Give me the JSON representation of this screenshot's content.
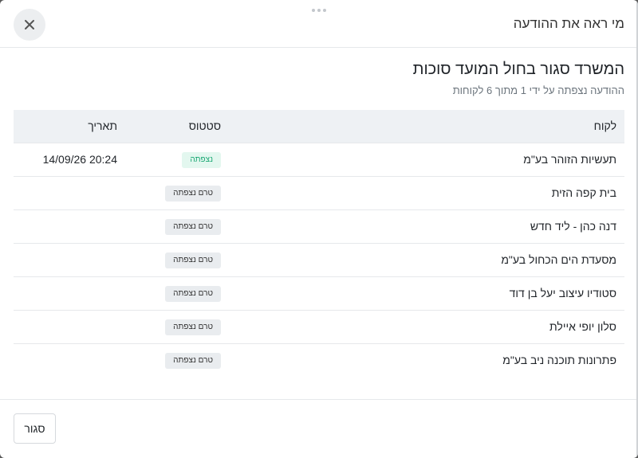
{
  "modal": {
    "title": "מי ראה את ההודעה",
    "close_label": "סגור"
  },
  "message": {
    "title": "המשרד סגור בחול המועד סוכות",
    "subtitle": "ההודעה נצפתה על ידי 1 מתוך 6 לקוחות"
  },
  "table": {
    "headers": {
      "customer": "לקוח",
      "status": "סטטוס",
      "date": "תאריך"
    },
    "rows": [
      {
        "customer": "תעשיות הזוהר בע\"מ",
        "status": "נצפתה",
        "status_type": "viewed",
        "date": "14/09/26 20:24"
      },
      {
        "customer": "בית קפה הזית",
        "status": "טרם נצפתה",
        "status_type": "not-viewed",
        "date": ""
      },
      {
        "customer": "דנה כהן - ליד חדש",
        "status": "טרם נצפתה",
        "status_type": "not-viewed",
        "date": ""
      },
      {
        "customer": "מסעדת הים הכחול בע\"מ",
        "status": "טרם נצפתה",
        "status_type": "not-viewed",
        "date": ""
      },
      {
        "customer": "סטודיו עיצוב יעל בן דוד",
        "status": "טרם נצפתה",
        "status_type": "not-viewed",
        "date": ""
      },
      {
        "customer": "סלון יופי איילת",
        "status": "טרם נצפתה",
        "status_type": "not-viewed",
        "date": ""
      },
      {
        "customer": "פתרונות תוכנה ניב בע\"מ",
        "status": "טרם נצפתה",
        "status_type": "not-viewed",
        "date": ""
      }
    ]
  },
  "colors": {
    "viewed_badge_bg": "#e3f7ef",
    "viewed_badge_text": "#1aa773",
    "not_viewed_badge_bg": "#e9ecef",
    "header_row_bg": "#eef1f4"
  },
  "icons": {
    "close": "close-icon",
    "drag": "drag-handle-icon"
  }
}
